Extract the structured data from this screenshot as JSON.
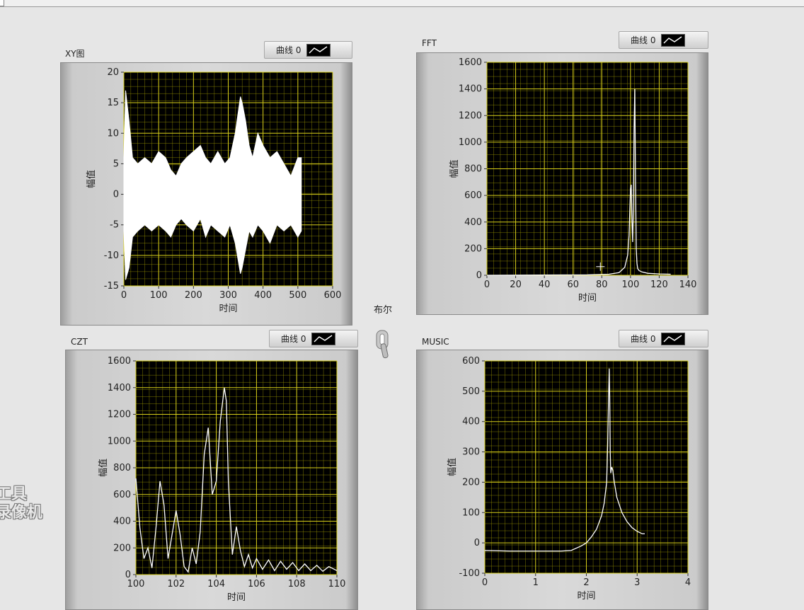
{
  "boolean_control": {
    "label": "布尔"
  },
  "watermark": {
    "line1": "工具",
    "line2": "录像机"
  },
  "colors": {
    "plot_bg": "#000000",
    "grid": "#a6a000",
    "trace": "#ffffff",
    "panel_bg": "#e6e6e6"
  },
  "icons": {
    "legend": "line-plot-icon",
    "switch": "toggle-switch-icon",
    "cursor": "crosshair-cursor-icon"
  },
  "chart_data": [
    {
      "id": "xy",
      "type": "line",
      "title": "XY图",
      "legend": "曲线 0",
      "xlabel": "时间",
      "ylabel": "幅值",
      "xlim": [
        0,
        600
      ],
      "ylim": [
        -15,
        20
      ],
      "xticks": [
        0,
        100,
        200,
        300,
        400,
        500,
        600
      ],
      "yticks": [
        -15,
        -10,
        -5,
        0,
        5,
        10,
        15,
        20
      ],
      "xtick_labels": [
        "0",
        "100",
        "200",
        "300",
        "400",
        "500",
        "600"
      ],
      "ytick_labels": [
        "-15",
        "-10",
        "-5",
        "0",
        "5",
        "10",
        "15",
        "20"
      ],
      "grid": true,
      "envelope": {
        "x": [
          0,
          5,
          15,
          25,
          40,
          60,
          80,
          100,
          120,
          135,
          150,
          165,
          180,
          200,
          220,
          235,
          250,
          270,
          290,
          305,
          320,
          335,
          340,
          350,
          360,
          370,
          385,
          400,
          420,
          440,
          460,
          480,
          500,
          510
        ],
        "upper": [
          6,
          17,
          12,
          6,
          5,
          6,
          5,
          7,
          6,
          4,
          3,
          5,
          6,
          7,
          8,
          6,
          5,
          7,
          5,
          6,
          10,
          16,
          15,
          12,
          8,
          6,
          10,
          8,
          6,
          7,
          5,
          3,
          6,
          6
        ],
        "lower": [
          -6,
          -14,
          -12,
          -7,
          -6,
          -5,
          -6,
          -5,
          -6,
          -7,
          -5,
          -4,
          -5,
          -6,
          -4,
          -7,
          -5,
          -6,
          -7,
          -5,
          -8,
          -13,
          -12,
          -9,
          -6,
          -7,
          -5,
          -6,
          -8,
          -5,
          -6,
          -5,
          -7,
          -6
        ]
      }
    },
    {
      "id": "fft",
      "type": "line",
      "title": "FFT",
      "legend": "曲线 0",
      "xlabel": "时间",
      "ylabel": "幅值",
      "xlim": [
        0,
        140
      ],
      "ylim": [
        0,
        1600
      ],
      "xticks": [
        0,
        20,
        40,
        60,
        80,
        100,
        120,
        140
      ],
      "yticks": [
        0,
        200,
        400,
        600,
        800,
        1000,
        1200,
        1400,
        1600
      ],
      "xtick_labels": [
        "0",
        "20",
        "40",
        "60",
        "80",
        "100",
        "120",
        "140"
      ],
      "ytick_labels": [
        "0",
        "200",
        "400",
        "600",
        "800",
        "1000",
        "1200",
        "1400",
        "1600"
      ],
      "grid": true,
      "x": [
        0,
        70,
        85,
        92,
        96,
        98,
        99,
        100,
        100.5,
        101,
        101.5,
        102,
        102.5,
        103,
        103.5,
        104,
        104.5,
        105,
        106,
        108,
        112,
        120,
        128
      ],
      "y": [
        0,
        3,
        8,
        20,
        60,
        150,
        300,
        650,
        680,
        420,
        250,
        500,
        1100,
        1400,
        700,
        200,
        90,
        50,
        35,
        25,
        15,
        10,
        8
      ]
    },
    {
      "id": "czt",
      "type": "line",
      "title": "CZT",
      "legend": "曲线 0",
      "xlabel": "时间",
      "ylabel": "幅值",
      "xlim": [
        100,
        110
      ],
      "ylim": [
        0,
        1600
      ],
      "xticks": [
        100,
        102,
        104,
        106,
        108,
        110
      ],
      "yticks": [
        0,
        200,
        400,
        600,
        800,
        1000,
        1200,
        1400,
        1600
      ],
      "xtick_labels": [
        "100",
        "102",
        "104",
        "106",
        "108",
        "110"
      ],
      "ytick_labels": [
        "0",
        "200",
        "400",
        "600",
        "800",
        "1000",
        "1200",
        "1400",
        "1600"
      ],
      "grid": true,
      "x": [
        100,
        100.2,
        100.4,
        100.6,
        100.8,
        101,
        101.2,
        101.4,
        101.6,
        101.8,
        102,
        102.2,
        102.4,
        102.6,
        102.8,
        103,
        103.2,
        103.4,
        103.6,
        103.8,
        104,
        104.2,
        104.4,
        104.5,
        104.6,
        104.8,
        105,
        105.2,
        105.4,
        105.6,
        105.8,
        106,
        106.3,
        106.6,
        106.9,
        107.2,
        107.5,
        107.8,
        108.1,
        108.4,
        108.7,
        109,
        109.3,
        109.6,
        110
      ],
      "y": [
        720,
        350,
        120,
        200,
        50,
        350,
        700,
        520,
        120,
        300,
        480,
        300,
        60,
        20,
        200,
        80,
        320,
        900,
        1100,
        600,
        700,
        1150,
        1400,
        1300,
        700,
        150,
        360,
        180,
        60,
        150,
        50,
        120,
        40,
        110,
        30,
        100,
        40,
        90,
        30,
        80,
        30,
        70,
        25,
        60,
        30
      ]
    },
    {
      "id": "music",
      "type": "line",
      "title": "MUSIC",
      "legend": "曲线 0",
      "xlabel": "时间",
      "ylabel": "幅值",
      "xlim": [
        0,
        4
      ],
      "ylim": [
        -100,
        600
      ],
      "xticks": [
        0,
        1,
        2,
        3,
        4
      ],
      "yticks": [
        -100,
        0,
        100,
        200,
        300,
        400,
        500,
        600
      ],
      "xtick_labels": [
        "0",
        "1",
        "2",
        "3",
        "4"
      ],
      "ytick_labels": [
        "-100",
        "0",
        "100",
        "200",
        "300",
        "400",
        "500",
        "600"
      ],
      "grid": true,
      "x": [
        0,
        0.5,
        1.0,
        1.5,
        1.7,
        1.9,
        2.0,
        2.1,
        2.2,
        2.3,
        2.35,
        2.4,
        2.42,
        2.44,
        2.45,
        2.46,
        2.47,
        2.48,
        2.5,
        2.52,
        2.55,
        2.6,
        2.7,
        2.8,
        2.9,
        3.0,
        3.1,
        3.15
      ],
      "y": [
        -25,
        -27,
        -27,
        -27,
        -25,
        -10,
        0,
        20,
        45,
        90,
        130,
        200,
        330,
        500,
        575,
        480,
        300,
        230,
        250,
        240,
        200,
        150,
        100,
        70,
        50,
        38,
        30,
        30
      ]
    }
  ]
}
